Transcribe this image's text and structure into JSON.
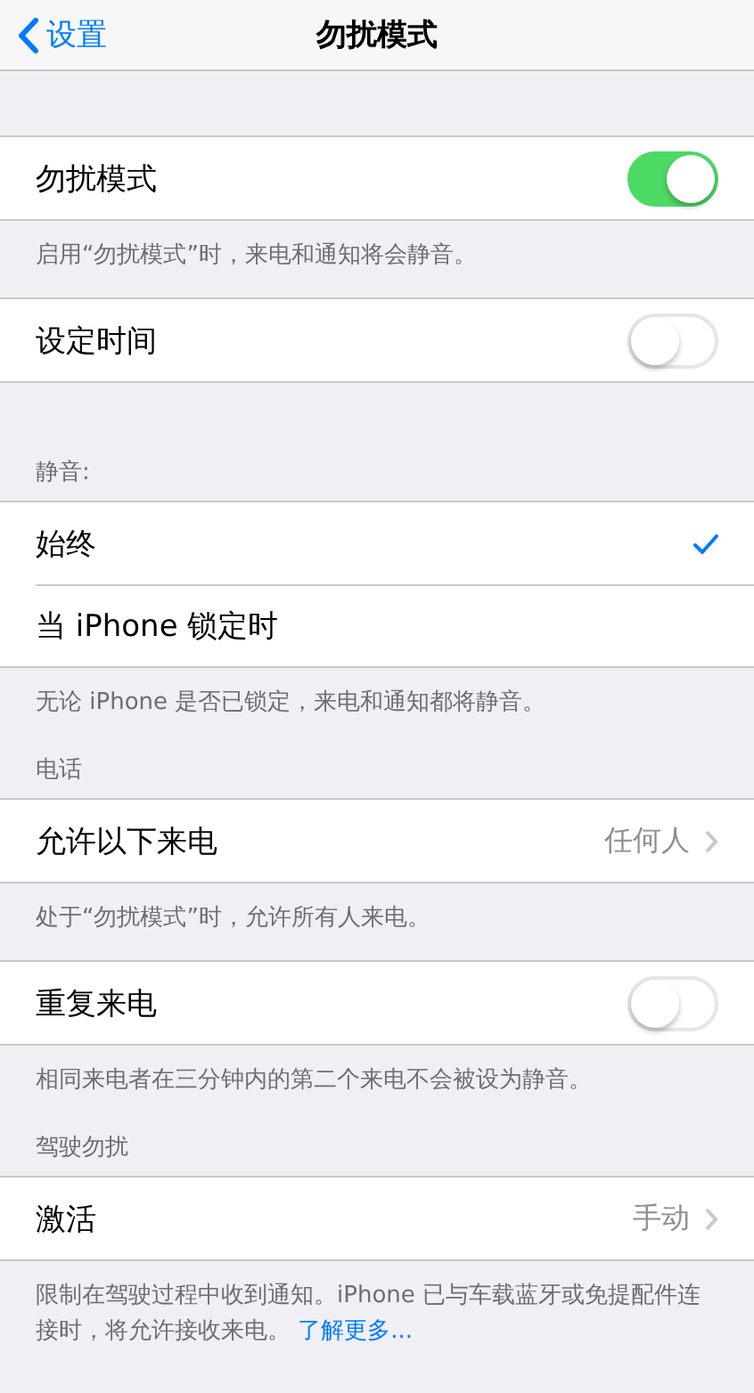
{
  "nav": {
    "back": "设置",
    "title": "勿扰模式"
  },
  "sections": [
    {
      "rows": [
        {
          "kind": "toggle",
          "label": "勿扰模式",
          "on": true
        }
      ],
      "footer": "启用“勿扰模式”时，来电和通知将会静音。"
    },
    {
      "rows": [
        {
          "kind": "toggle",
          "label": "设定时间",
          "on": false
        }
      ]
    },
    {
      "header": "静音:",
      "rows": [
        {
          "kind": "choice",
          "label": "始终",
          "selected": true
        },
        {
          "kind": "choice",
          "label": "当 iPhone 锁定时",
          "selected": false
        }
      ],
      "footer": "无论 iPhone 是否已锁定，来电和通知都将静音。"
    },
    {
      "header": "电话",
      "rows": [
        {
          "kind": "link",
          "label": "允许以下来电",
          "value": "任何人"
        }
      ],
      "footer": "处于“勿扰模式”时，允许所有人来电。"
    },
    {
      "rows": [
        {
          "kind": "toggle",
          "label": "重复来电",
          "on": false
        }
      ],
      "footer": "相同来电者在三分钟内的第二个来电不会被设为静音。"
    },
    {
      "header": "驾驶勿扰",
      "rows": [
        {
          "kind": "link",
          "label": "激活",
          "value": "手动"
        }
      ],
      "footer": "限制在驾驶过程中收到通知。iPhone 已与车载蓝牙或免提配件连接时，将允许接收来电。",
      "footer_link": "了解更多..."
    }
  ]
}
